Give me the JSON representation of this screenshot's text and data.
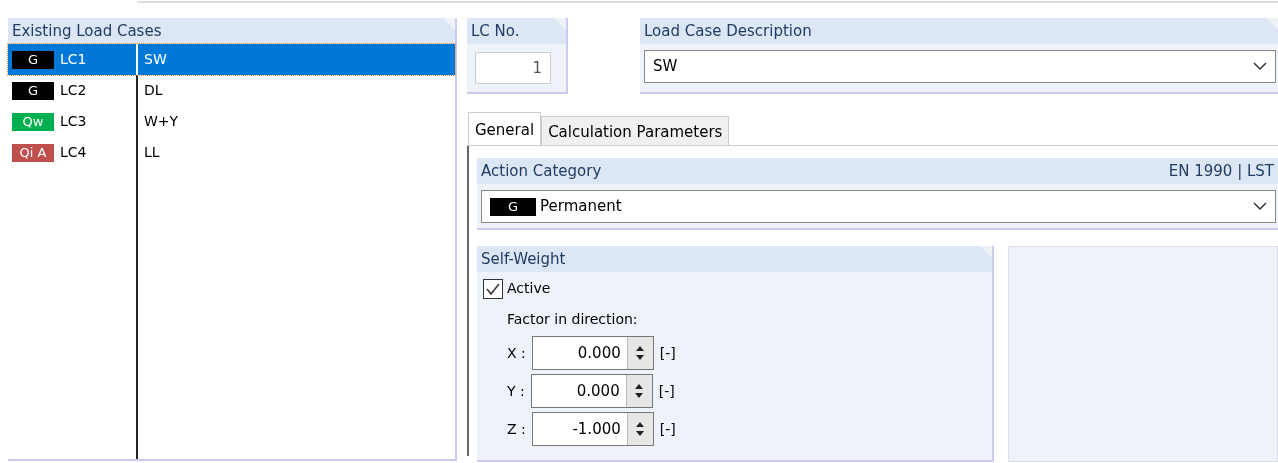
{
  "load_cases": {
    "title": "Existing Load Cases",
    "rows": [
      {
        "tag": "G",
        "color": "#000000",
        "number": "LC1",
        "description": "SW",
        "selected": true
      },
      {
        "tag": "G",
        "color": "#000000",
        "number": "LC2",
        "description": "DL",
        "selected": false
      },
      {
        "tag": "Qw",
        "color": "#00b050",
        "number": "LC3",
        "description": "W+Y",
        "selected": false
      },
      {
        "tag": "Qi A",
        "color": "#c0504d",
        "number": "LC4",
        "description": "LL",
        "selected": false
      }
    ]
  },
  "lc_no": {
    "title": "LC No.",
    "value": "1"
  },
  "description": {
    "title": "Load Case Description",
    "value": "SW"
  },
  "tabs": [
    {
      "label": "General",
      "selected": true
    },
    {
      "label": "Calculation Parameters",
      "selected": false
    }
  ],
  "action_category": {
    "title": "Action Category",
    "standard": "EN 1990 | LST",
    "tag": "G",
    "color": "#000000",
    "value": "Permanent"
  },
  "self_weight": {
    "title": "Self-Weight",
    "active_label": "Active",
    "checked": true,
    "factor_label": "Factor in direction:",
    "factors": [
      {
        "axis": "X :",
        "value": "0.000",
        "unit": "[-]"
      },
      {
        "axis": "Y :",
        "value": "0.000",
        "unit": "[-]"
      },
      {
        "axis": "Z :",
        "value": "-1.000",
        "unit": "[-]"
      }
    ]
  }
}
